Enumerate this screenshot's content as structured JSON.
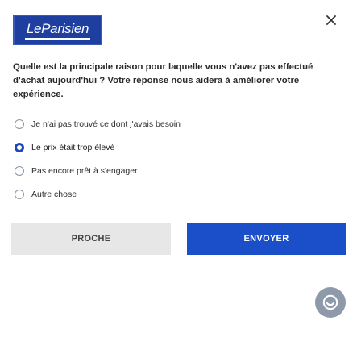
{
  "logo": {
    "text": "LeParisien"
  },
  "question": "Quelle est la principale raison pour laquelle vous n'avez pas effectué d'achat aujourd'hui ? Votre réponse nous aidera à améliorer votre expérience.",
  "options": [
    {
      "label": "Je n'ai pas trouvé ce dont j'avais besoin",
      "selected": false
    },
    {
      "label": "Le prix était trop élevé",
      "selected": true
    },
    {
      "label": "Pas encore prêt à s'engager",
      "selected": false
    },
    {
      "label": "Autre chose",
      "selected": false
    }
  ],
  "buttons": {
    "close_label": "PROCHE",
    "submit_label": "ENVOYER"
  },
  "icons": {
    "close": "close-icon",
    "chat": "chat-icon"
  },
  "colors": {
    "brand": "#1f3fa0",
    "accent": "#1b4ec9",
    "secondary_button": "#e7e7e7",
    "chat_button": "#8e9aaa"
  }
}
